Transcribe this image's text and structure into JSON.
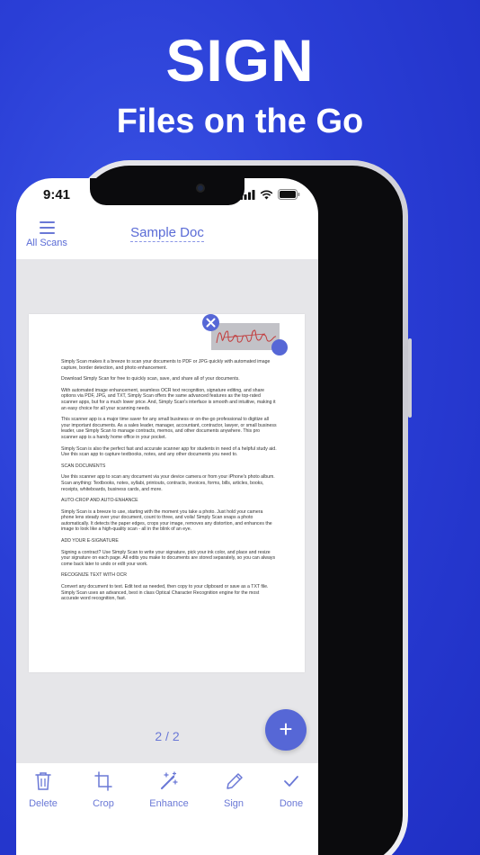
{
  "marketing": {
    "title": "SIGN",
    "subtitle": "Files on the Go"
  },
  "status_bar": {
    "time": "9:41"
  },
  "header": {
    "menu_label": "All Scans",
    "doc_title": "Sample Doc"
  },
  "document": {
    "paragraphs": [
      "Simply Scan makes it a breeze to scan your documents to PDF or JPG quickly with automated image capture, border detection, and photo enhancement.",
      "Download Simply Scan for free to quickly scan, save, and share all of your documents.",
      "With automated image enhancement, seamless OCR text recognition, signature editing, and share options via PDF, JPG, and TXT, Simply Scan offers the same advanced features as the top-rated scanner apps, but for a much lower price. And, Simply Scan's interface is smooth and intuitive, making it an easy choice for all your scanning needs.",
      "This scanner app is a major time saver for any small business or on-the-go professional to digitize all your important documents. As a sales leader, manager, accountant, contractor, lawyer, or small business leader, use Simply Scan to manage contracts, memos, and other documents anywhere. This pro scanner app is a handy home office in your pocket.",
      "Simply Scan is also the perfect fast and accurate scanner app for students in need of a helpful study aid. Use this scan app to capture textbooks, notes, and any other documents you need to.",
      "SCAN DOCUMENTS",
      "Use this scanner app to scan any document via your device camera or from your iPhone's photo album. Scan anything: Textbooks, notes, syllabi, printouts, contracts, invoices, forms, bills, articles, books, receipts, whiteboards, business cards, and more.",
      "AUTO-CROP AND AUTO-ENHANCE",
      "Simply Scan is a breeze to use, starting with the moment you take a photo. Just hold your camera phone lens steady over your document, count to three, and voila! Simply Scan snaps a photo automatically. It detects the paper edges, crops your image, removes any distortion, and enhances the image to look like a high-quality scan - all in the blink of an eye.",
      "ADD YOUR E-SIGNATURE",
      "Signing a contract? Use Simply Scan to write your signature, pick your ink color, and place and resize your signature on each page. All edits you make to documents are stored separately, so you can always come back later to undo or edit your work.",
      "RECOGNIZE TEXT WITH OCR",
      "Convert any document to text. Edit text as needed, then copy to your clipboard or save as a TXT file. Simply Scan uses an advanced, best in class Optical Character Recognition engine for the most accurate word recognition, fast."
    ]
  },
  "pager": {
    "label": "2 / 2"
  },
  "fab": {
    "label": "+"
  },
  "toolbar": {
    "delete": "Delete",
    "crop": "Crop",
    "enhance": "Enhance",
    "sign": "Sign",
    "done": "Done"
  },
  "colors": {
    "accent": "#5667d6",
    "background": "#2a3ed6",
    "signature_ink": "#c23a3a"
  }
}
